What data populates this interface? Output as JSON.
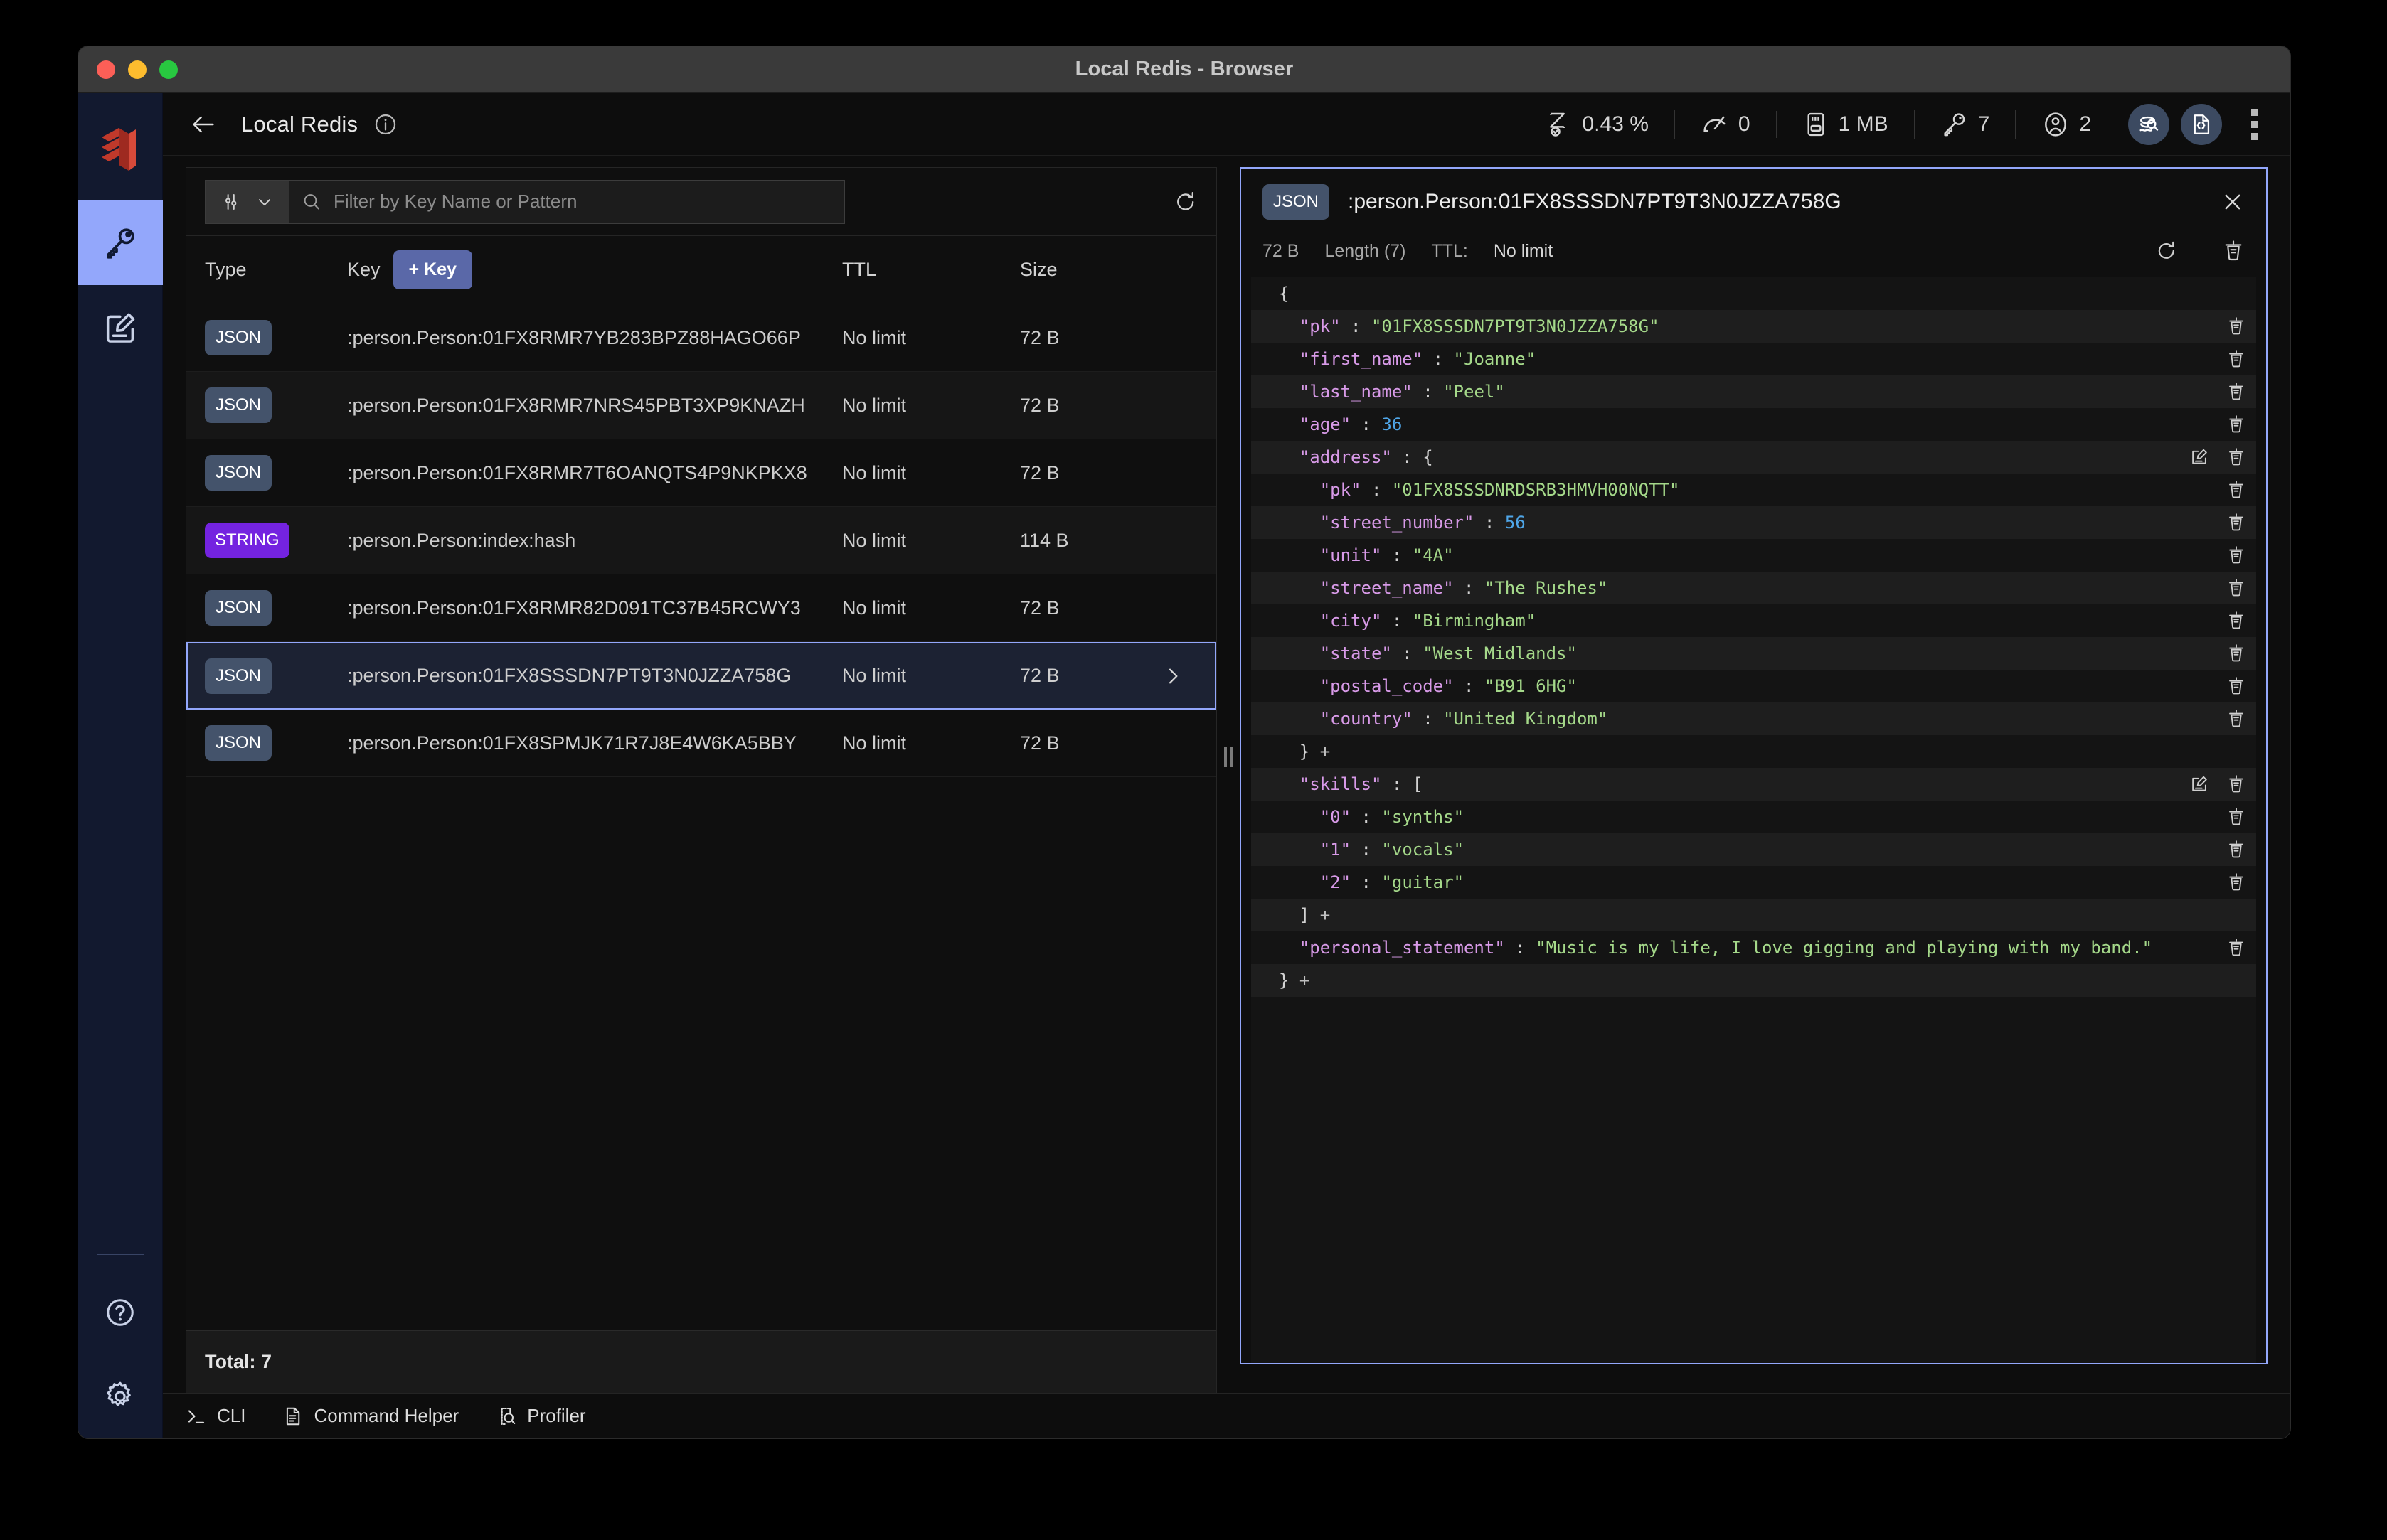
{
  "window": {
    "title": "Local Redis - Browser"
  },
  "header": {
    "db_name": "Local Redis",
    "metrics": [
      {
        "icon": "cpu-hourglass-icon",
        "value": "0.43 %"
      },
      {
        "icon": "gauge-icon",
        "value": "0"
      },
      {
        "icon": "memory-card-icon",
        "value": "1 MB"
      },
      {
        "icon": "key-icon",
        "value": "7"
      },
      {
        "icon": "user-icon",
        "value": "2"
      }
    ],
    "actions": [
      {
        "icon": "redis-stack-search-icon"
      },
      {
        "icon": "json-document-icon"
      },
      {
        "icon": "kebab-menu-icon"
      }
    ]
  },
  "sidebar": {
    "items": [
      {
        "icon": "key-icon",
        "active": true
      },
      {
        "icon": "edit-document-icon",
        "active": false
      }
    ],
    "bottom_items": [
      {
        "icon": "help-circle-icon"
      },
      {
        "icon": "gear-icon"
      }
    ]
  },
  "keylist": {
    "filter": {
      "placeholder": "Filter by Key Name or Pattern",
      "value": "",
      "type_icon": "filter-sliders-icon",
      "chevron_icon": "chevron-down-icon",
      "search_icon": "search-icon",
      "refresh_icon": "refresh-icon"
    },
    "columns": {
      "type": "Type",
      "key": "Key",
      "ttl": "TTL",
      "size": "Size"
    },
    "add_key_label": "+ Key",
    "rows": [
      {
        "type": "JSON",
        "key": ":person.Person:01FX8RMR7YB283BPZ88HAGO66P",
        "ttl": "No limit",
        "size": "72 B",
        "selected": false
      },
      {
        "type": "JSON",
        "key": ":person.Person:01FX8RMR7NRS45PBT3XP9KNAZH",
        "ttl": "No limit",
        "size": "72 B",
        "selected": false
      },
      {
        "type": "JSON",
        "key": ":person.Person:01FX8RMR7T6OANQTS4P9NKPKX8",
        "ttl": "No limit",
        "size": "72 B",
        "selected": false
      },
      {
        "type": "STRING",
        "key": ":person.Person:index:hash",
        "ttl": "No limit",
        "size": "114 B",
        "selected": false
      },
      {
        "type": "JSON",
        "key": ":person.Person:01FX8RMR82D091TC37B45RCWY3",
        "ttl": "No limit",
        "size": "72 B",
        "selected": false
      },
      {
        "type": "JSON",
        "key": ":person.Person:01FX8SSSDN7PT9T3N0JZZA758G",
        "ttl": "No limit",
        "size": "72 B",
        "selected": true
      },
      {
        "type": "JSON",
        "key": ":person.Person:01FX8SPMJK71R7J8E4W6KA5BBY",
        "ttl": "No limit",
        "size": "72 B",
        "selected": false
      }
    ],
    "total_label": "Total: 7"
  },
  "detail": {
    "type_badge": "JSON",
    "key": ":person.Person:01FX8SSSDN7PT9T3N0JZZA758G",
    "size": "72 B",
    "length": "Length (7)",
    "ttl_label": "TTL:",
    "ttl_value": "No limit",
    "close_icon": "close-icon",
    "refresh_icon": "refresh-icon",
    "delete_icon": "trash-icon",
    "json_lines": [
      {
        "indent": 0,
        "tokens": [
          {
            "t": "p",
            "v": "{"
          }
        ],
        "edit": false,
        "del": false
      },
      {
        "indent": 1,
        "tokens": [
          {
            "t": "k",
            "v": "\"pk\""
          },
          {
            "t": "p",
            "v": " : "
          },
          {
            "t": "s",
            "v": "\"01FX8SSSDN7PT9T3N0JZZA758G\""
          }
        ],
        "edit": false,
        "del": true
      },
      {
        "indent": 1,
        "tokens": [
          {
            "t": "k",
            "v": "\"first_name\""
          },
          {
            "t": "p",
            "v": " : "
          },
          {
            "t": "s",
            "v": "\"Joanne\""
          }
        ],
        "edit": false,
        "del": true
      },
      {
        "indent": 1,
        "tokens": [
          {
            "t": "k",
            "v": "\"last_name\""
          },
          {
            "t": "p",
            "v": " : "
          },
          {
            "t": "s",
            "v": "\"Peel\""
          }
        ],
        "edit": false,
        "del": true
      },
      {
        "indent": 1,
        "tokens": [
          {
            "t": "k",
            "v": "\"age\""
          },
          {
            "t": "p",
            "v": " : "
          },
          {
            "t": "n",
            "v": "36"
          }
        ],
        "edit": false,
        "del": true
      },
      {
        "indent": 1,
        "tokens": [
          {
            "t": "k",
            "v": "\"address\""
          },
          {
            "t": "p",
            "v": " : {"
          }
        ],
        "edit": true,
        "del": true
      },
      {
        "indent": 2,
        "tokens": [
          {
            "t": "k",
            "v": "\"pk\""
          },
          {
            "t": "p",
            "v": " : "
          },
          {
            "t": "s",
            "v": "\"01FX8SSSDNRDSRB3HMVH00NQTT\""
          }
        ],
        "edit": false,
        "del": true
      },
      {
        "indent": 2,
        "tokens": [
          {
            "t": "k",
            "v": "\"street_number\""
          },
          {
            "t": "p",
            "v": " : "
          },
          {
            "t": "n",
            "v": "56"
          }
        ],
        "edit": false,
        "del": true
      },
      {
        "indent": 2,
        "tokens": [
          {
            "t": "k",
            "v": "\"unit\""
          },
          {
            "t": "p",
            "v": " : "
          },
          {
            "t": "s",
            "v": "\"4A\""
          }
        ],
        "edit": false,
        "del": true
      },
      {
        "indent": 2,
        "tokens": [
          {
            "t": "k",
            "v": "\"street_name\""
          },
          {
            "t": "p",
            "v": " : "
          },
          {
            "t": "s",
            "v": "\"The Rushes\""
          }
        ],
        "edit": false,
        "del": true
      },
      {
        "indent": 2,
        "tokens": [
          {
            "t": "k",
            "v": "\"city\""
          },
          {
            "t": "p",
            "v": " : "
          },
          {
            "t": "s",
            "v": "\"Birmingham\""
          }
        ],
        "edit": false,
        "del": true
      },
      {
        "indent": 2,
        "tokens": [
          {
            "t": "k",
            "v": "\"state\""
          },
          {
            "t": "p",
            "v": " : "
          },
          {
            "t": "s",
            "v": "\"West Midlands\""
          }
        ],
        "edit": false,
        "del": true
      },
      {
        "indent": 2,
        "tokens": [
          {
            "t": "k",
            "v": "\"postal_code\""
          },
          {
            "t": "p",
            "v": " : "
          },
          {
            "t": "s",
            "v": "\"B91 6HG\""
          }
        ],
        "edit": false,
        "del": true
      },
      {
        "indent": 2,
        "tokens": [
          {
            "t": "k",
            "v": "\"country\""
          },
          {
            "t": "p",
            "v": " : "
          },
          {
            "t": "s",
            "v": "\"United Kingdom\""
          }
        ],
        "edit": false,
        "del": true
      },
      {
        "indent": 1,
        "tokens": [
          {
            "t": "p",
            "v": "} "
          },
          {
            "t": "plus",
            "v": "+"
          }
        ],
        "edit": false,
        "del": false
      },
      {
        "indent": 1,
        "tokens": [
          {
            "t": "k",
            "v": "\"skills\""
          },
          {
            "t": "p",
            "v": " : ["
          }
        ],
        "edit": true,
        "del": true
      },
      {
        "indent": 2,
        "tokens": [
          {
            "t": "k",
            "v": "\"0\""
          },
          {
            "t": "p",
            "v": " : "
          },
          {
            "t": "s",
            "v": "\"synths\""
          }
        ],
        "edit": false,
        "del": true
      },
      {
        "indent": 2,
        "tokens": [
          {
            "t": "k",
            "v": "\"1\""
          },
          {
            "t": "p",
            "v": " : "
          },
          {
            "t": "s",
            "v": "\"vocals\""
          }
        ],
        "edit": false,
        "del": true
      },
      {
        "indent": 2,
        "tokens": [
          {
            "t": "k",
            "v": "\"2\""
          },
          {
            "t": "p",
            "v": " : "
          },
          {
            "t": "s",
            "v": "\"guitar\""
          }
        ],
        "edit": false,
        "del": true
      },
      {
        "indent": 1,
        "tokens": [
          {
            "t": "p",
            "v": "] "
          },
          {
            "t": "plus",
            "v": "+"
          }
        ],
        "edit": false,
        "del": false
      },
      {
        "indent": 1,
        "tokens": [
          {
            "t": "k",
            "v": "\"personal_statement\""
          },
          {
            "t": "p",
            "v": " : "
          },
          {
            "t": "s",
            "v": "\"Music is my life, I love gigging and playing with my band.\""
          }
        ],
        "edit": false,
        "del": true
      },
      {
        "indent": 0,
        "tokens": [
          {
            "t": "p",
            "v": "} "
          },
          {
            "t": "plus",
            "v": "+"
          }
        ],
        "edit": false,
        "del": false
      }
    ]
  },
  "footer": {
    "items": [
      {
        "icon": "terminal-prompt-icon",
        "label": "CLI"
      },
      {
        "icon": "document-lines-icon",
        "label": "Command Helper"
      },
      {
        "icon": "profiler-scan-icon",
        "label": "Profiler"
      }
    ]
  }
}
